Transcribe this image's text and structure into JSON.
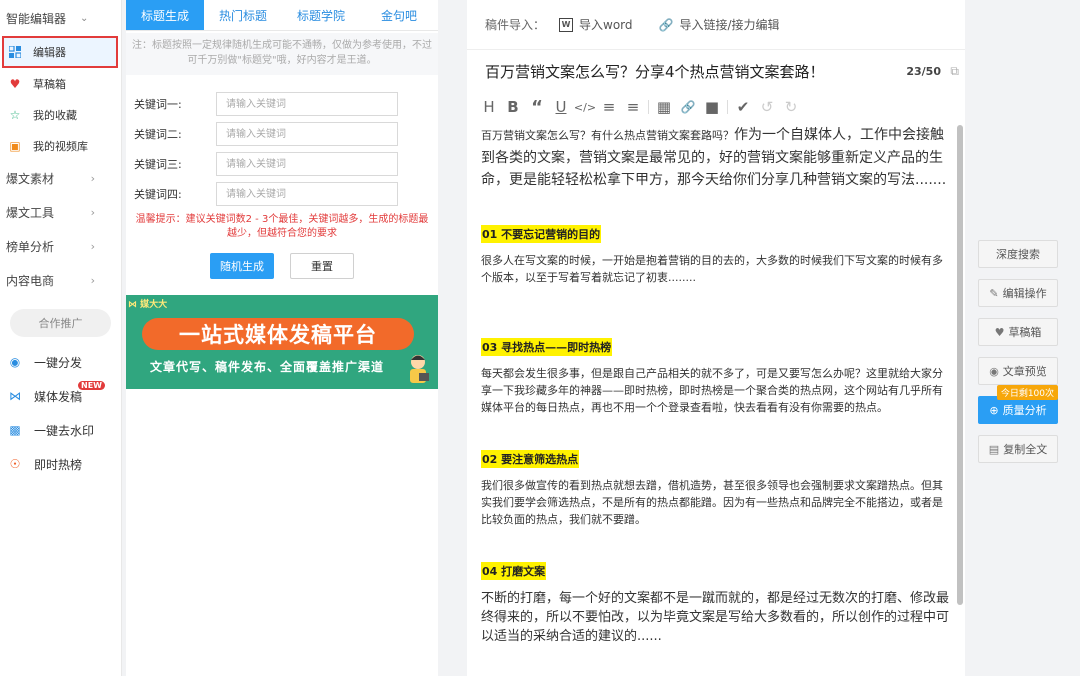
{
  "sidebar": {
    "header": "智能编辑器",
    "items": [
      {
        "label": "编辑器",
        "icon": "grid-icon"
      },
      {
        "label": "草稿箱",
        "icon": "draft-icon"
      },
      {
        "label": "我的收藏",
        "icon": "star-icon"
      },
      {
        "label": "我的视频库",
        "icon": "video-icon"
      }
    ],
    "groups": [
      "爆文素材",
      "爆文工具",
      "榜单分析",
      "内容电商"
    ],
    "partner_label": "合作推广",
    "partner_items": [
      {
        "label": "一键分发",
        "icon": "distribute-icon"
      },
      {
        "label": "媒体发稿",
        "icon": "media-icon",
        "badge": "NEW"
      },
      {
        "label": "一键去水印",
        "icon": "watermark-icon"
      },
      {
        "label": "即时热榜",
        "icon": "hot-icon"
      }
    ]
  },
  "title_tool": {
    "tabs": [
      "标题生成",
      "热门标题",
      "标题学院",
      "金句吧"
    ],
    "active_tab": "标题生成",
    "notice": "注：标题按照一定规律随机生成可能不通畅，仅做为参考使用，不过可千万别做\"标题党\"哦，好内容才是王道。",
    "keywords": [
      {
        "label": "关键词一:",
        "placeholder": "请输入关键词"
      },
      {
        "label": "关键词二:",
        "placeholder": "请输入关键词"
      },
      {
        "label": "关键词三:",
        "placeholder": "请输入关键词"
      },
      {
        "label": "关键词四:",
        "placeholder": "请输入关键词"
      }
    ],
    "tip": "温馨提示：建议关键词数2 - 3个最佳，关键词越多，生成的标题最越少，但越符合您的要求",
    "generate_label": "随机生成",
    "reset_label": "重置",
    "banner": {
      "logo": "媒大大",
      "headline": "一站式媒体发稿平台",
      "subline": "文章代写、稿件发布、全面覆盖推广渠道"
    }
  },
  "editor": {
    "import_label": "稿件导入：",
    "import_word": "导入word",
    "import_link": "导入链接/接力编辑",
    "title": "百万营销文案怎么写？分享4个热点营销文案套路！",
    "title_count": "23/50",
    "toolbar": [
      "H",
      "B",
      "“",
      "U",
      "</>",
      "ordered-list-icon",
      "bullet-list-icon",
      "image-icon",
      "link-icon",
      "video-icon",
      "clear-format-icon",
      "undo-icon",
      "redo-icon"
    ],
    "intro_small": "百万营销文案怎么写？有什么热点营销文案套路吗？",
    "intro_large": "作为一个自媒体人，工作中会接触到各类的文案，营销文案是最常见的，好的营销文案能够重新定义产品的生命，更是能轻轻松松拿下甲方，那今天给你们分享几种营销文案的写法.......",
    "sections": [
      {
        "heading": "01 不要忘记营销的目的",
        "body": "很多人在写文案的时候，一开始是抱着营销的目的去的，大多数的时候我们下写文案的时候有多个版本，以至于写着写着就忘记了初衷........"
      },
      {
        "heading": "03 寻找热点——即时热榜",
        "body": "每天都会发生很多事，但是跟自己产品相关的就不多了，可是又要写怎么办呢？这里就给大家分享一下我珍藏多年的神器——即时热榜，即时热榜是一个聚合类的热点网，这个网站有几乎所有媒体平台的每日热点，再也不用一个个登录查看啦，快去看看有没有你需要的热点。"
      },
      {
        "heading": "02 要注意筛选热点",
        "body": "我们很多做宣传的看到热点就想去蹭，借机造势，甚至很多领导也会强制要求文案蹭热点。但其实我们要学会筛选热点，不是所有的热点都能蹭。因为有一些热点和品牌完全不能搭边，或者是比较负面的热点，我们就不要蹭。"
      },
      {
        "heading": "04 打磨文案",
        "body": "不断的打磨，每一个好的文案都不是一蹴而就的，都是经过无数次的打磨、修改最终得来的，所以不要怕改，以为毕竟文案是写给大多数看的，所以创作的过程中可以适当的采纳合适的建议的......"
      }
    ]
  },
  "tools": {
    "items": [
      {
        "label": "深度搜索",
        "icon": ""
      },
      {
        "label": "编辑操作",
        "icon": "edit-icon"
      },
      {
        "label": "草稿箱",
        "icon": "draft-icon"
      },
      {
        "label": "文章预览",
        "icon": "eye-icon"
      },
      {
        "label": "质量分析",
        "icon": "plus-circle-icon"
      },
      {
        "label": "复制全文",
        "icon": "copy-icon"
      }
    ],
    "promo": "今日剩100次"
  },
  "colors": {
    "accent": "#2a9ef4",
    "highlight": "#fff200",
    "warning": "#e23b3b",
    "banner_bg": "#30a67f",
    "banner_pill": "#f26a2a"
  }
}
